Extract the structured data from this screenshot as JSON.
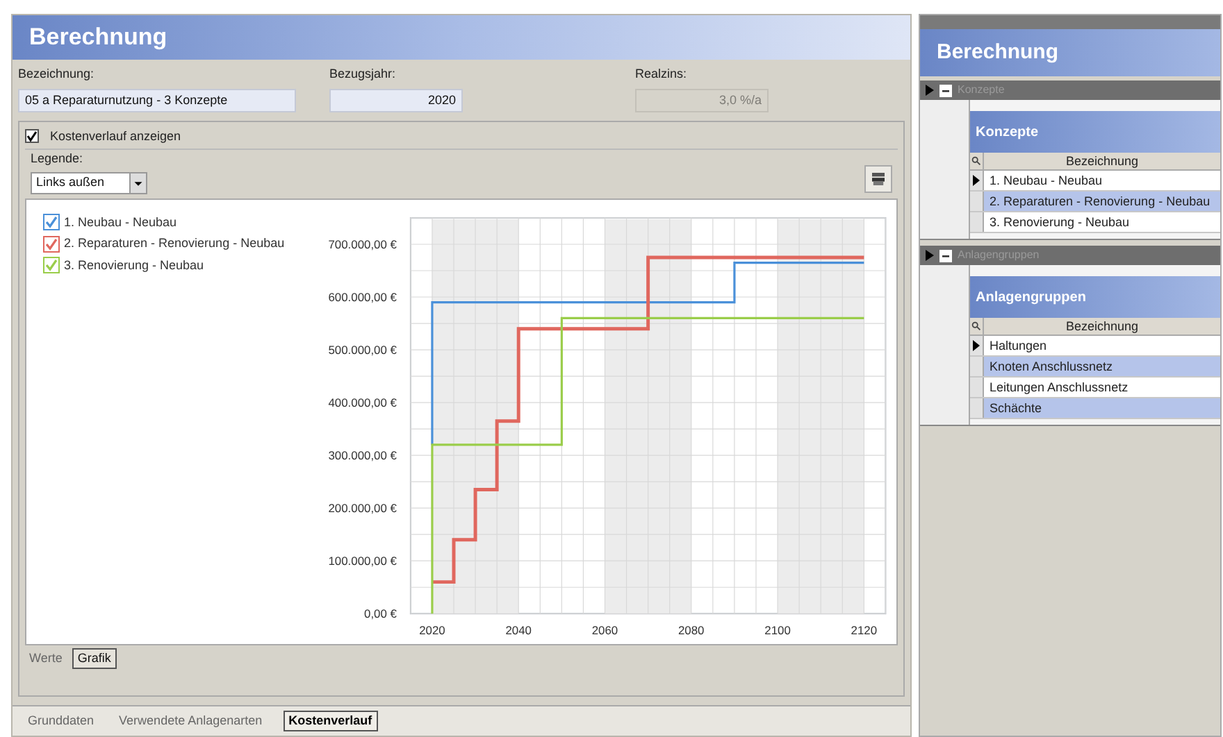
{
  "main": {
    "title": "Berechnung",
    "fields": [
      {
        "label": "Bezeichnung:",
        "value": "05 a Reparaturnutzung - 3 Konzepte",
        "disabled": false
      },
      {
        "label": "Bezugsjahr:",
        "value": "2020",
        "disabled": false
      },
      {
        "label": "Realzins:",
        "value": "3,0 %/a",
        "disabled": true
      }
    ],
    "show_checkbox": {
      "label": "Kostenverlauf anzeigen",
      "checked": true
    },
    "legend_label": "Legende:",
    "legend_select": "Links außen",
    "legend": [
      {
        "checked": true
      },
      {
        "checked": true
      },
      {
        "checked": true
      }
    ],
    "chart_data": {
      "type": "line",
      "x": [
        2020,
        2020,
        2025,
        2025,
        2030,
        2030,
        2035,
        2035,
        2040,
        2040,
        2050,
        2050,
        2070,
        2070,
        2090,
        2090,
        2120
      ],
      "series": [
        {
          "name": "1. Neubau - Neubau",
          "color": "#4a90d9",
          "values": [
            320000,
            590000,
            590000,
            590000,
            590000,
            590000,
            590000,
            590000,
            590000,
            590000,
            590000,
            590000,
            590000,
            590000,
            590000,
            665000,
            665000
          ]
        },
        {
          "name": "2. Reparaturen - Renovierung - Neubau",
          "color": "#e0675e",
          "values": [
            60000,
            60000,
            60000,
            140000,
            140000,
            235000,
            235000,
            365000,
            365000,
            540000,
            540000,
            540000,
            540000,
            675000,
            675000,
            675000,
            675000
          ]
        },
        {
          "name": "3. Renovierung - Neubau",
          "color": "#9acd4a",
          "values": [
            0,
            320000,
            320000,
            320000,
            320000,
            320000,
            320000,
            320000,
            320000,
            320000,
            320000,
            560000,
            560000,
            560000,
            560000,
            560000,
            560000
          ]
        }
      ],
      "xlim": [
        2015,
        2125
      ],
      "ylim": [
        0,
        750000
      ],
      "grid": true,
      "xticks": [
        2020,
        2040,
        2060,
        2080,
        2100,
        2120
      ],
      "yticks": [
        {
          "value": 0,
          "label": "0,00 €"
        },
        {
          "value": 100000,
          "label": "100.000,00 €"
        },
        {
          "value": 200000,
          "label": "200.000,00 €"
        },
        {
          "value": 300000,
          "label": "300.000,00 €"
        },
        {
          "value": 400000,
          "label": "400.000,00 €"
        },
        {
          "value": 500000,
          "label": "500.000,00 €"
        },
        {
          "value": 600000,
          "label": "600.000,00 €"
        },
        {
          "value": 700000,
          "label": "700.000,00 €"
        }
      ]
    },
    "view_tabs": [
      {
        "label": "Werte",
        "selected": false
      },
      {
        "label": "Grafik",
        "selected": true
      }
    ],
    "bottom_tabs": [
      {
        "label": "Grunddaten",
        "selected": false
      },
      {
        "label": "Verwendete Anlagenarten",
        "selected": false
      },
      {
        "label": "Kostenverlauf",
        "selected": true
      }
    ]
  },
  "side": {
    "title": "Berechnung",
    "groups": [
      {
        "bar": "Konzepte",
        "title": "Konzepte",
        "column": "Bezeichnung",
        "rows": [
          {
            "text": "1. Neubau - Neubau",
            "selected": true
          },
          {
            "text": "2. Reparaturen - Renovierung - Neubau",
            "selected": false
          },
          {
            "text": "3. Renovierung - Neubau",
            "selected": false
          }
        ]
      },
      {
        "bar": "Anlagengruppen",
        "title": "Anlagengruppen",
        "column": "Bezeichnung",
        "rows": [
          {
            "text": "Haltungen",
            "selected": true
          },
          {
            "text": "Knoten Anschlussnetz",
            "selected": false
          },
          {
            "text": "Leitungen Anschlussnetz",
            "selected": false
          },
          {
            "text": "Schächte",
            "selected": false
          }
        ]
      }
    ]
  }
}
